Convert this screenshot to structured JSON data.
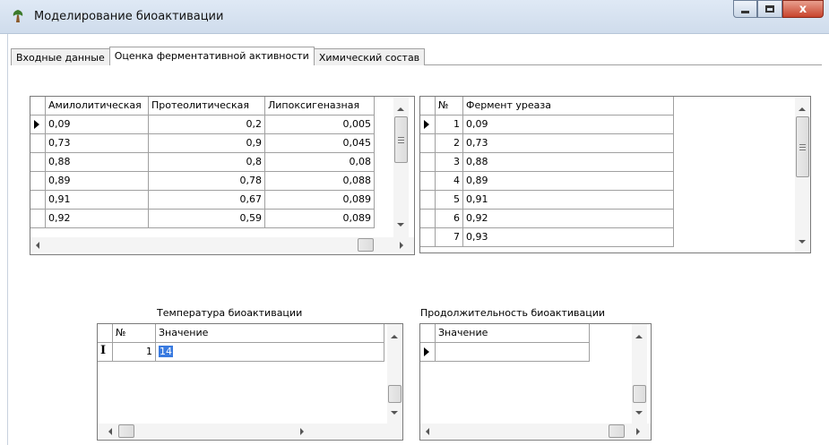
{
  "window": {
    "title": "Моделирование биоактивации",
    "close_glyph": "x"
  },
  "tabs": [
    {
      "label": "Входные данные",
      "active": false
    },
    {
      "label": "Оценка ферментативной активности",
      "active": true
    },
    {
      "label": "Химический состав",
      "active": false
    }
  ],
  "activity_table": {
    "columns": [
      "Амилолитическая",
      "Протеолитическая",
      "Липоксигеназная"
    ],
    "rows": [
      [
        "0,09",
        "0,2",
        "0,005"
      ],
      [
        "0,73",
        "0,9",
        "0,045"
      ],
      [
        "0,88",
        "0,8",
        "0,08"
      ],
      [
        "0,89",
        "0,78",
        "0,088"
      ],
      [
        "0,91",
        "0,67",
        "0,089"
      ],
      [
        "0,92",
        "0,59",
        "0,089"
      ]
    ]
  },
  "urease_table": {
    "columns": [
      "№",
      "Фермент уреаза"
    ],
    "rows": [
      [
        "1",
        "0,09"
      ],
      [
        "2",
        "0,73"
      ],
      [
        "3",
        "0,88"
      ],
      [
        "4",
        "0,89"
      ],
      [
        "5",
        "0,91"
      ],
      [
        "6",
        "0,92"
      ],
      [
        "7",
        "0,93"
      ]
    ]
  },
  "temperature": {
    "caption": "Температура биоактивации",
    "columns": [
      "№",
      "Значение"
    ],
    "rows": [
      [
        "1",
        "14"
      ]
    ]
  },
  "duration": {
    "caption": "Продолжительность биоактивации",
    "columns": [
      "Значение"
    ]
  },
  "colors": {
    "selection": "#3a7be0",
    "close_button": "#c7432c"
  },
  "icons": {
    "app": "tree-icon",
    "row_indicator": "row-pointer-icon",
    "edit_cursor": "text-cursor-icon"
  }
}
